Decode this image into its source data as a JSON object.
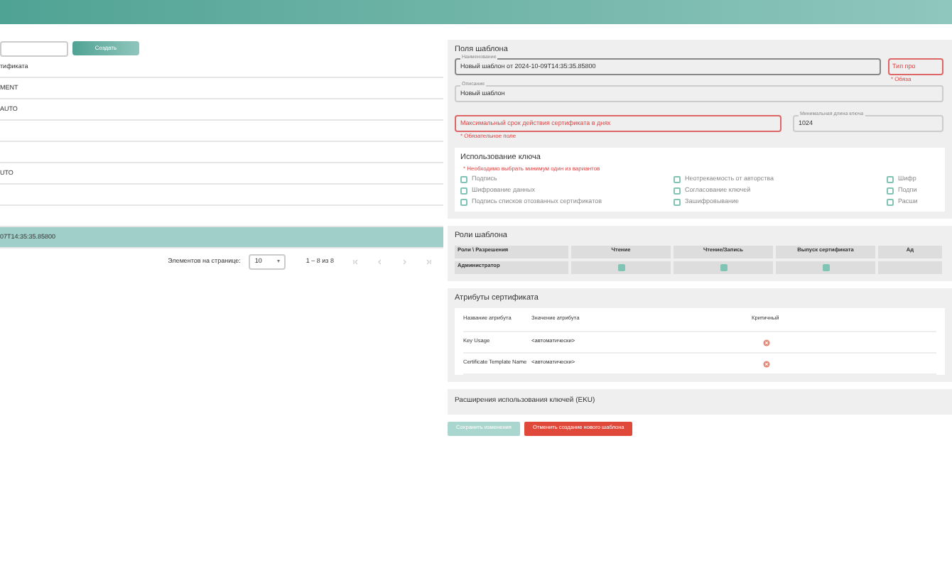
{
  "left": {
    "create_button": "Создать",
    "column": "тификата",
    "rows": [
      {
        "text": "MENT",
        "selected": false
      },
      {
        "text": "AUTO",
        "selected": false
      },
      {
        "selected": false
      },
      {
        "selected": false
      },
      {
        "text": "UTO",
        "selected": false
      },
      {
        "selected": false
      },
      {
        "selected": false
      },
      {
        "text": "07T14:35:35.85800",
        "selected": true
      }
    ],
    "pagination": {
      "label": "Элементов на странице:",
      "page_size": "10",
      "range": "1 – 8 из 8"
    }
  },
  "template_fields": {
    "title": "Поля шаблона",
    "name": {
      "label": "Наименование",
      "value": "Новый шаблон от 2024-10-09T14:35:35.85800"
    },
    "type": {
      "placeholder": "Тип про",
      "error": "* Обяза"
    },
    "description": {
      "label": "Описание",
      "value": "Новый шаблон"
    },
    "max_validity": {
      "placeholder": "Максимальный срок действия сертификата в днях",
      "error": "* Обязательное поле"
    },
    "min_key_length": {
      "label": "Минимальная длина ключа",
      "value": "1024"
    },
    "key_usage": {
      "title": "Использование ключа",
      "error": "* Необходимо выбрать минимум один из вариантов",
      "options": [
        {
          "label": "Подпись",
          "checked": false
        },
        {
          "label": "Неотрекаемость от авторства",
          "checked": false
        },
        {
          "label": "Шифр",
          "checked": false
        },
        {
          "label": "Шифрование данных",
          "checked": false
        },
        {
          "label": "Согласование ключей",
          "checked": false
        },
        {
          "label": "Подпи",
          "checked": false
        },
        {
          "label": "Подпись списков отозванных сертификатов",
          "checked": false
        },
        {
          "label": "Зашифровывание",
          "checked": false
        },
        {
          "label": "Расши",
          "checked": false
        }
      ]
    }
  },
  "roles": {
    "title": "Роли шаблона",
    "columns": [
      "Роли \\ Разрешения",
      "Чтение",
      "Чтение/Запись",
      "Выпуск сертификата",
      "Ад"
    ],
    "rows": [
      {
        "name": "Администратор",
        "permissions": [
          true,
          true,
          true
        ]
      }
    ]
  },
  "attributes": {
    "title": "Атрибуты сертификата",
    "columns": [
      "Название атрибута",
      "Значение атрибута",
      "Критичный"
    ],
    "rows": [
      {
        "name": "Key Usage",
        "value": "<автоматически>",
        "critical": false
      },
      {
        "name": "Certificate Template Name",
        "value": "<автоматически>",
        "critical": false
      }
    ]
  },
  "eku": {
    "title": "Расширения использования ключей (EKU)"
  },
  "buttons": [
    {
      "label": "Сохранить изменения",
      "kind": "save",
      "disabled": true
    },
    {
      "label": "Отменить создание нового шаблона",
      "kind": "cancel",
      "disabled": false
    }
  ]
}
